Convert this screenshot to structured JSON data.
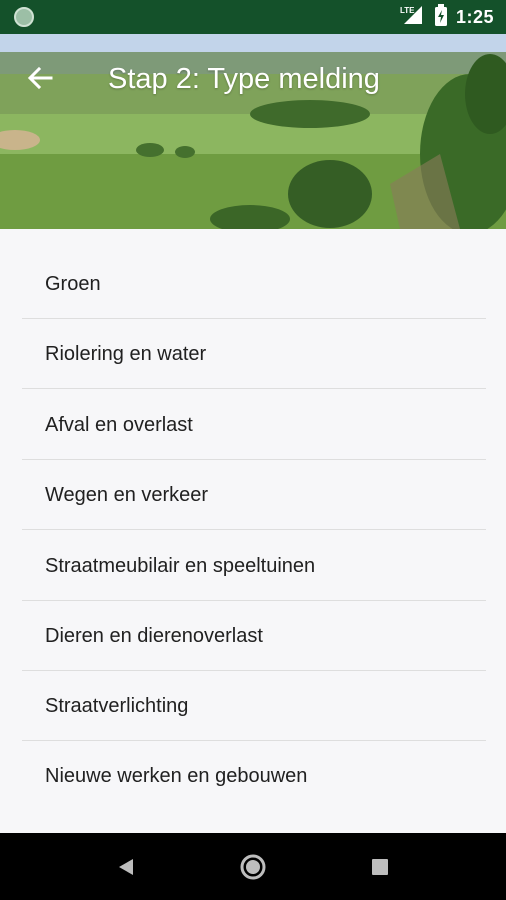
{
  "status_bar": {
    "network_label": "LTE",
    "time": "1:25"
  },
  "header": {
    "title": "Stap 2: Type melding",
    "back_icon": "arrow-left-icon"
  },
  "list": {
    "items": [
      {
        "label": "Groen"
      },
      {
        "label": "Riolering en water"
      },
      {
        "label": "Afval en overlast"
      },
      {
        "label": "Wegen en verkeer"
      },
      {
        "label": "Straatmeubilair en speeltuinen"
      },
      {
        "label": "Dieren en dierenoverlast"
      },
      {
        "label": "Straatverlichting"
      },
      {
        "label": "Nieuwe werken en gebouwen"
      }
    ]
  },
  "nav_bar": {
    "buttons": [
      "back-triangle-icon",
      "home-circle-icon",
      "recents-square-icon"
    ]
  },
  "colors": {
    "status_bar": "#14512a",
    "list_background": "#f7f7f9",
    "text": "#212121"
  }
}
